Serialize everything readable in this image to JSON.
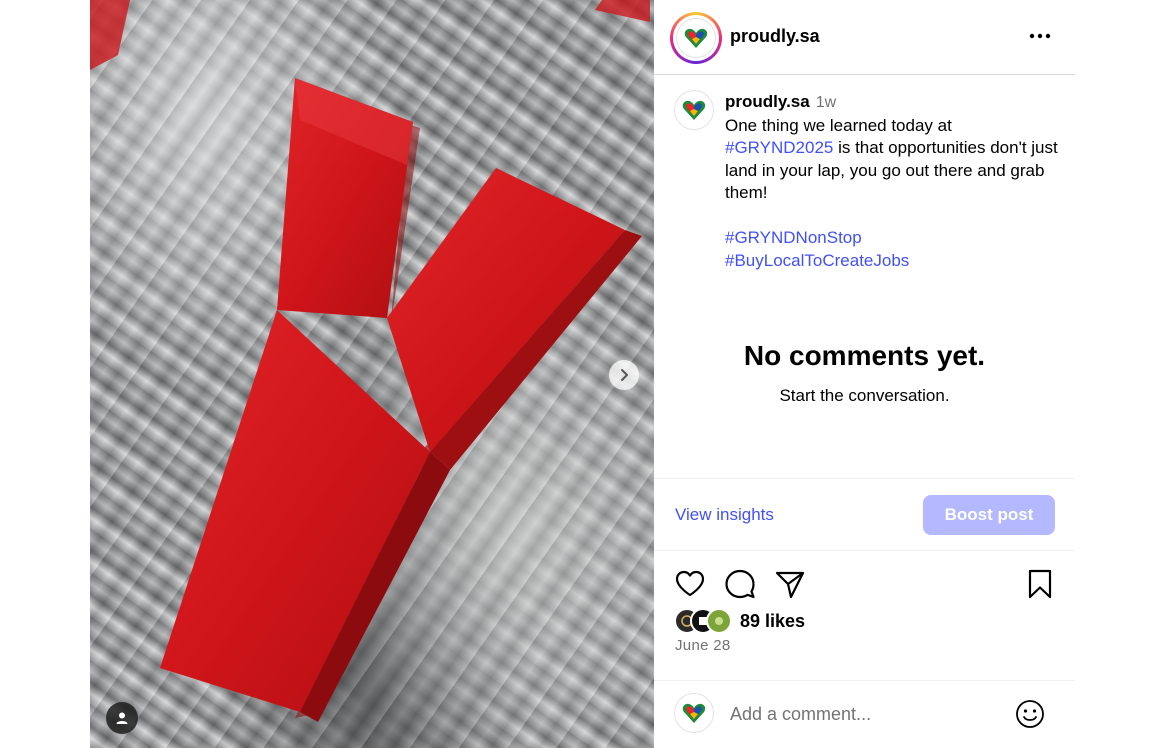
{
  "header": {
    "username": "proudly.sa",
    "more_icon": "more-horizontal-icon"
  },
  "caption": {
    "username": "proudly.sa",
    "time": "1w",
    "text_before": "One thing we learned today at ",
    "hashtag1": "#GRYND2025",
    "text_after": " is that opportunities don't just land in your lap, you go out there and grab them!",
    "hashtag2": "#GRYNDNonStop",
    "hashtag3": "#BuyLocalToCreateJobs"
  },
  "comments": {
    "empty_title": "No comments yet.",
    "empty_subtitle": "Start the conversation."
  },
  "insights": {
    "view_label": "View insights",
    "boost_label": "Boost post"
  },
  "actions": {
    "icons": [
      "heart-icon",
      "comment-icon",
      "share-icon",
      "bookmark-icon"
    ]
  },
  "likes": {
    "text": "89 likes"
  },
  "post": {
    "date": "June 28"
  },
  "comment_box": {
    "placeholder": "Add a comment...",
    "emoji_icon": "emoji-icon"
  },
  "colors": {
    "link": "#4150f7",
    "boost_button": "#b4b8ff",
    "letter_red": "#d4161b",
    "muted_text": "#737373"
  }
}
